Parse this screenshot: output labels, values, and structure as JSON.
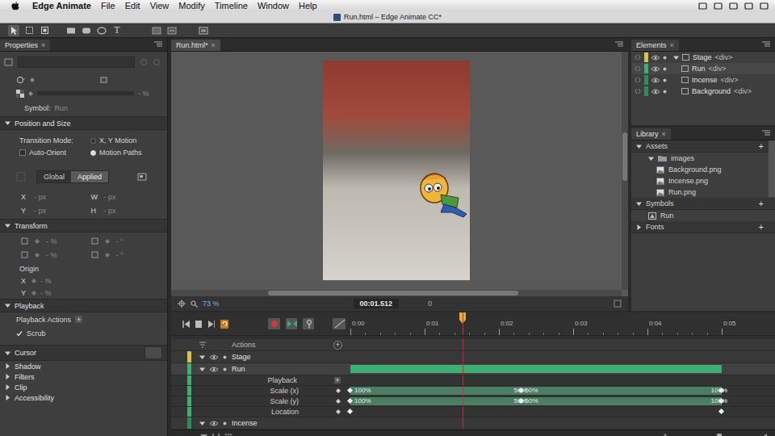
{
  "menu_bar": {
    "app": "Edge Animate",
    "items": [
      "File",
      "Edit",
      "View",
      "Modify",
      "Timeline",
      "Window",
      "Help"
    ]
  },
  "window": {
    "title": "Run.html – Edge Animate CC*"
  },
  "toolbar": {
    "text_tool": "T"
  },
  "properties": {
    "tab": {
      "label": "Properties",
      "close": "×"
    },
    "opacity_reading": "- %",
    "symbol": {
      "label": "Symbol:",
      "value": "Run"
    },
    "position_section": {
      "title": "Position and Size",
      "expanded": true
    },
    "transition_mode": {
      "label": "Transition Mode:",
      "options": [
        {
          "label": "X, Y Motion",
          "selected": false
        },
        {
          "label": "Motion Paths",
          "selected": true
        }
      ]
    },
    "auto_orient": {
      "label": "Auto-Orient",
      "checked": false
    },
    "coord_tabs": [
      {
        "label": "Global",
        "selected": false
      },
      {
        "label": "Applied",
        "selected": true
      }
    ],
    "position_fields": [
      {
        "label": "X",
        "value": "- px"
      },
      {
        "label": "W",
        "value": "- px"
      },
      {
        "label": "Y",
        "value": "- px"
      },
      {
        "label": "H",
        "value": "- px"
      }
    ],
    "transform_section": {
      "title": "Transform",
      "expanded": true
    },
    "transform_fields": [
      "- %",
      "- °",
      "- %",
      "- °"
    ],
    "origin": {
      "label": "Origin",
      "fields": [
        {
          "label": "X",
          "value": "- %"
        },
        {
          "label": "Y",
          "value": "- %"
        }
      ]
    },
    "playback_section": {
      "title": "Playback",
      "expanded": true
    },
    "playback_actions": {
      "label": "Playback Actions",
      "add": "+"
    },
    "scrub": {
      "label": "Scrub",
      "checked": true
    },
    "cursor_section": {
      "title": "Cursor",
      "expanded": true
    },
    "collapsed_sections": [
      {
        "title": "Shadow",
        "expanded": false
      },
      {
        "title": "Filters",
        "expanded": false
      },
      {
        "title": "Clip",
        "expanded": false
      },
      {
        "title": "Accessibility",
        "expanded": false
      }
    ]
  },
  "document": {
    "tab": {
      "label": "Run.html*",
      "close": "×"
    },
    "zoom": "73 %",
    "time": "00:01.512",
    "frame": "0"
  },
  "elements": {
    "tab": {
      "label": "Elements",
      "close": "×"
    },
    "items": [
      {
        "name": "Stage",
        "tag": "<div>",
        "depth": 0,
        "expanded": true,
        "selected": false,
        "color": "#d8c24a"
      },
      {
        "name": "Run",
        "tag": "<div>",
        "depth": 1,
        "selected": true,
        "color": "#3fae74"
      },
      {
        "name": "Incense",
        "tag": "<div>",
        "depth": 1,
        "selected": false,
        "color": "#2f8a5c"
      },
      {
        "name": "Background",
        "tag": "<div>",
        "depth": 1,
        "selected": false,
        "color": "#2f8a5c"
      }
    ]
  },
  "library": {
    "tab": {
      "label": "Library",
      "close": "×"
    },
    "sections": [
      {
        "title": "Assets",
        "add": "+",
        "expanded": true,
        "items": [
          {
            "name": "images",
            "kind": "folder",
            "expanded": true,
            "depth": 1
          },
          {
            "name": "Background.png",
            "kind": "image",
            "depth": 2
          },
          {
            "name": "Incense.png",
            "kind": "image",
            "depth": 2
          },
          {
            "name": "Run.png",
            "kind": "image",
            "depth": 2
          }
        ]
      },
      {
        "title": "Symbols",
        "add": "+",
        "expanded": true,
        "items": [
          {
            "name": "Run",
            "kind": "symbol",
            "depth": 1
          }
        ]
      },
      {
        "title": "Fonts",
        "add": "+",
        "expanded": false,
        "items": []
      }
    ]
  },
  "timeline": {
    "playhead": 1.512,
    "ruler": [
      "0:00",
      "0:01",
      "0:02",
      "0:03",
      "0:04",
      "0:05"
    ],
    "rows": [
      {
        "kind": "actions",
        "name": "Actions",
        "add": "+"
      },
      {
        "kind": "element",
        "name": "Stage",
        "color": "#d8c24a",
        "expanded": true,
        "selected": false
      },
      {
        "kind": "element",
        "name": "Run",
        "color": "#3fae74",
        "expanded": true,
        "selected": true,
        "bar": [
          0,
          5
        ]
      },
      {
        "kind": "property",
        "name": "Playback",
        "add": "+",
        "keys": []
      },
      {
        "kind": "property",
        "name": "Scale (x)",
        "band": true,
        "keys": [
          {
            "t": 0,
            "left": "",
            "right": "100%"
          },
          {
            "t": 2.3,
            "left": "50%",
            "right": "50%"
          },
          {
            "t": 5,
            "left": "100%",
            "right": ""
          }
        ]
      },
      {
        "kind": "property",
        "name": "Scale (y)",
        "band": true,
        "keys": [
          {
            "t": 0,
            "left": "",
            "right": "100%"
          },
          {
            "t": 2.3,
            "left": "50%",
            "right": "50%"
          },
          {
            "t": 5,
            "left": "100%",
            "right": ""
          }
        ]
      },
      {
        "kind": "property",
        "name": "Location",
        "band": false,
        "keys": [
          {
            "t": 0,
            "left": "",
            "right": ""
          },
          {
            "t": 5,
            "left": "",
            "right": ""
          }
        ]
      },
      {
        "kind": "element",
        "name": "Incense",
        "color": "#2f8a5c",
        "expanded": true,
        "selected": false
      }
    ]
  }
}
